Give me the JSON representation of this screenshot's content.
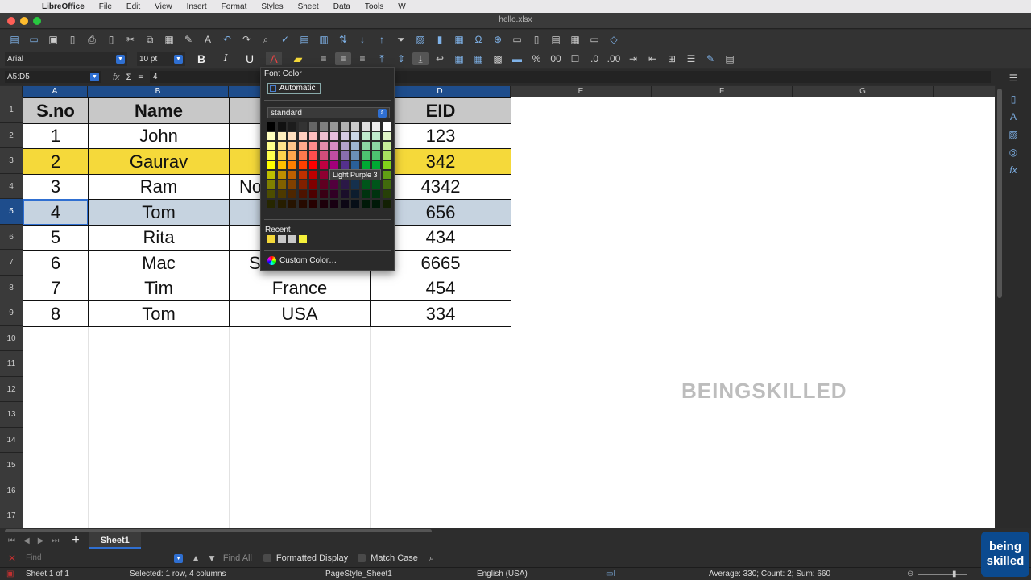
{
  "menu": {
    "app_name": "LibreOffice",
    "items": [
      "File",
      "Edit",
      "View",
      "Insert",
      "Format",
      "Styles",
      "Sheet",
      "Data",
      "Tools",
      "W"
    ]
  },
  "window": {
    "title": "hello.xlsx"
  },
  "format_toolbar": {
    "font_name": "Arial",
    "font_size": "10 pt",
    "bold": "B",
    "italic": "I",
    "underline": "U"
  },
  "formula_bar": {
    "name_box": "A5:D5",
    "sigma": "Σ",
    "equals": "=",
    "content": "4"
  },
  "columns": [
    "A",
    "B",
    "C",
    "D",
    "E",
    "F",
    "G"
  ],
  "rows": [
    "1",
    "2",
    "3",
    "4",
    "5",
    "6",
    "7",
    "8",
    "9",
    "10",
    "11",
    "12",
    "13",
    "14",
    "15",
    "16",
    "17"
  ],
  "table": {
    "headers": [
      "S.no",
      "Name",
      "",
      "EID"
    ],
    "rows": [
      [
        "1",
        "John",
        "",
        "123"
      ],
      [
        "2",
        "Gaurav",
        "",
        "342"
      ],
      [
        "3",
        "Ram",
        "No",
        "4342"
      ],
      [
        "4",
        "Tom",
        "",
        "656"
      ],
      [
        "5",
        "Rita",
        "",
        "434"
      ],
      [
        "6",
        "Mac",
        "S",
        "6665"
      ],
      [
        "7",
        "Tim",
        "France",
        "454"
      ],
      [
        "8",
        "Tom",
        "USA",
        "334"
      ]
    ]
  },
  "font_color_popup": {
    "title": "Font Color",
    "automatic": "Automatic",
    "palette": "standard",
    "tooltip": "Light Purple 3",
    "recent_label": "Recent",
    "recent_colors": [
      "#f5d93a",
      "#c8c8c8",
      "#c8c8c8",
      "#f5f03a"
    ],
    "custom_label": "Custom Color…"
  },
  "sheet_tabs": {
    "active": "Sheet1"
  },
  "find_bar": {
    "placeholder": "Find",
    "find_all": "Find All",
    "formatted_display": "Formatted Display",
    "match_case": "Match Case"
  },
  "status_bar": {
    "sheet": "Sheet 1 of 1",
    "selection": "Selected: 1 row, 4 columns",
    "page_style": "PageStyle_Sheet1",
    "language": "English (USA)",
    "summary": "Average: 330; Count: 2; Sum: 660"
  },
  "watermark": "BEINGSKILLED",
  "logo": {
    "line1": "being",
    "line2": "skilled"
  }
}
